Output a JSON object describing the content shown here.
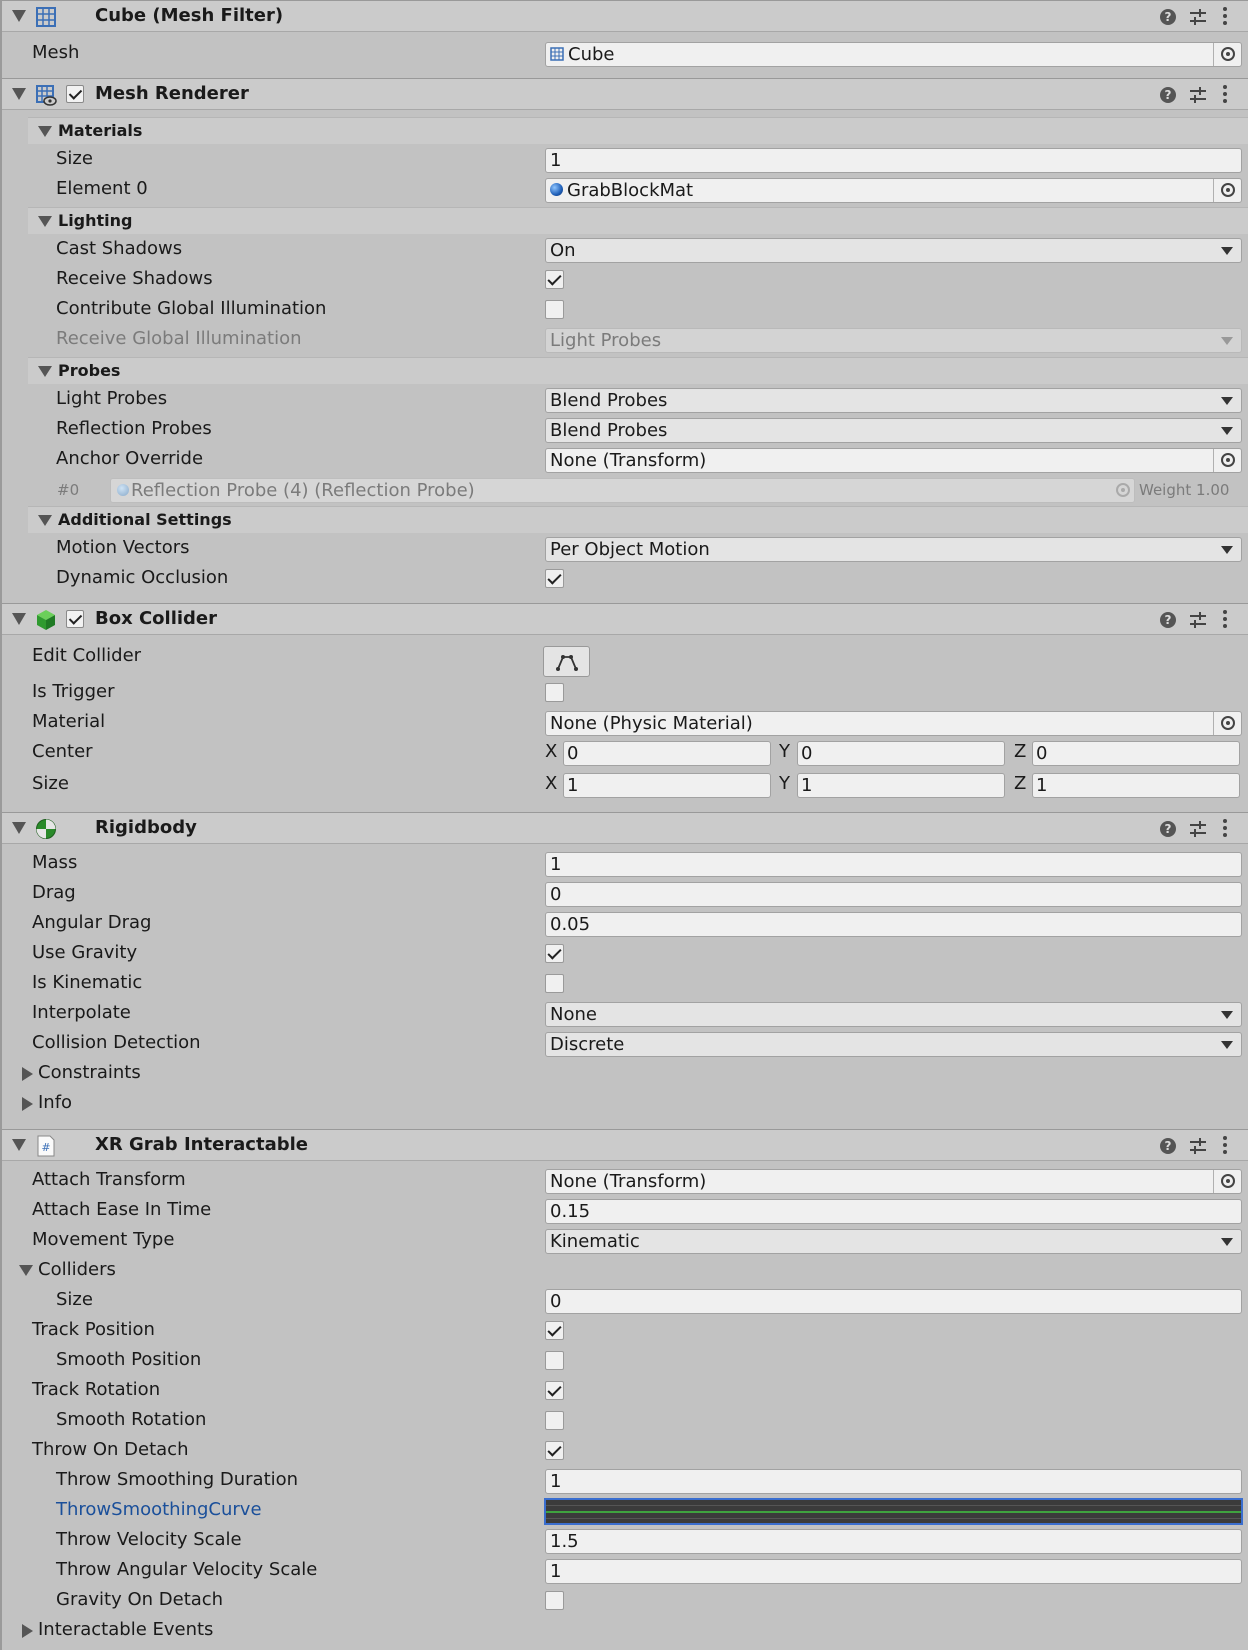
{
  "mesh_filter": {
    "title": "Cube (Mesh Filter)",
    "mesh_label": "Mesh",
    "mesh_value": "Cube"
  },
  "mesh_renderer": {
    "title": "Mesh Renderer",
    "materials": {
      "header": "Materials",
      "size_label": "Size",
      "size_value": "1",
      "element0_label": "Element 0",
      "element0_value": "GrabBlockMat"
    },
    "lighting": {
      "header": "Lighting",
      "cast_shadows_label": "Cast Shadows",
      "cast_shadows_value": "On",
      "receive_shadows_label": "Receive Shadows",
      "contribute_gi_label": "Contribute Global Illumination",
      "receive_gi_label": "Receive Global Illumination",
      "receive_gi_value": "Light Probes"
    },
    "probes": {
      "header": "Probes",
      "light_probes_label": "Light Probes",
      "light_probes_value": "Blend Probes",
      "reflection_probes_label": "Reflection Probes",
      "reflection_probes_value": "Blend Probes",
      "anchor_override_label": "Anchor Override",
      "anchor_override_value": "None (Transform)",
      "probe_index": "#0",
      "probe_name": "Reflection Probe (4) (Reflection Probe)",
      "probe_weight": "Weight 1.00"
    },
    "additional": {
      "header": "Additional Settings",
      "motion_vectors_label": "Motion Vectors",
      "motion_vectors_value": "Per Object Motion",
      "dynamic_occlusion_label": "Dynamic Occlusion"
    }
  },
  "box_collider": {
    "title": "Box Collider",
    "edit_collider_label": "Edit Collider",
    "is_trigger_label": "Is Trigger",
    "material_label": "Material",
    "material_value": "None (Physic Material)",
    "center_label": "Center",
    "center": {
      "x": "0",
      "y": "0",
      "z": "0"
    },
    "size_label": "Size",
    "size": {
      "x": "1",
      "y": "1",
      "z": "1"
    },
    "axis": {
      "x": "X",
      "y": "Y",
      "z": "Z"
    }
  },
  "rigidbody": {
    "title": "Rigidbody",
    "mass_label": "Mass",
    "mass_value": "1",
    "drag_label": "Drag",
    "drag_value": "0",
    "angular_drag_label": "Angular Drag",
    "angular_drag_value": "0.05",
    "use_gravity_label": "Use Gravity",
    "is_kinematic_label": "Is Kinematic",
    "interpolate_label": "Interpolate",
    "interpolate_value": "None",
    "collision_label": "Collision Detection",
    "collision_value": "Discrete",
    "constraints_label": "Constraints",
    "info_label": "Info"
  },
  "xr_grab": {
    "title": "XR Grab Interactable",
    "attach_transform_label": "Attach Transform",
    "attach_transform_value": "None (Transform)",
    "attach_ease_label": "Attach Ease In Time",
    "attach_ease_value": "0.15",
    "movement_type_label": "Movement Type",
    "movement_type_value": "Kinematic",
    "colliders_label": "Colliders",
    "colliders_size_label": "Size",
    "colliders_size_value": "0",
    "track_position_label": "Track Position",
    "smooth_position_label": "Smooth Position",
    "track_rotation_label": "Track Rotation",
    "smooth_rotation_label": "Smooth Rotation",
    "throw_on_detach_label": "Throw On Detach",
    "throw_smoothing_duration_label": "Throw Smoothing Duration",
    "throw_smoothing_duration_value": "1",
    "throw_smoothing_curve_label": "ThrowSmoothingCurve",
    "throw_velocity_scale_label": "Throw Velocity Scale",
    "throw_velocity_scale_value": "1.5",
    "throw_angular_velocity_scale_label": "Throw Angular Velocity Scale",
    "throw_angular_velocity_scale_value": "1",
    "gravity_on_detach_label": "Gravity On Detach",
    "interactable_events_label": "Interactable Events"
  },
  "header_icons": {
    "help": "?",
    "preset": "preset-icon",
    "menu": "kebab-menu-icon"
  }
}
